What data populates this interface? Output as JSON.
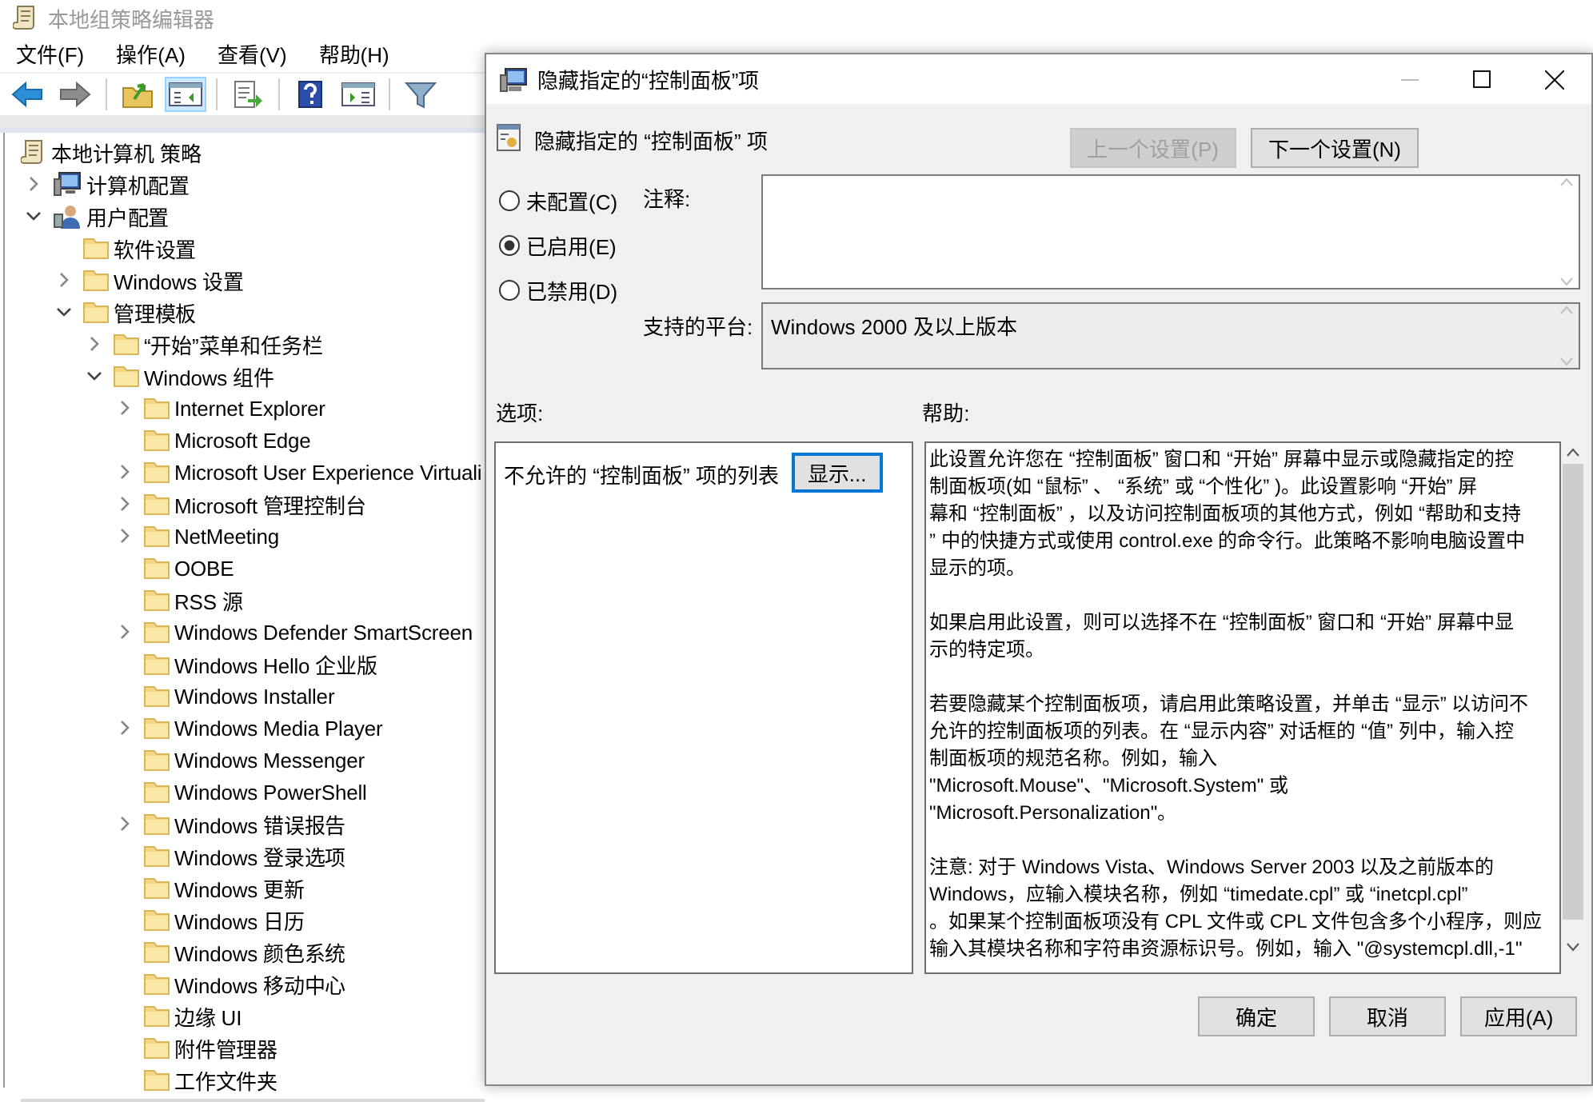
{
  "editor": {
    "title": "本地组策略编辑器",
    "menu": [
      "文件(F)",
      "操作(A)",
      "查看(V)",
      "帮助(H)"
    ],
    "toolbar": [
      [
        {
          "kind": "back",
          "pressed": false
        },
        {
          "kind": "forward",
          "pressed": false
        }
      ],
      [
        {
          "kind": "up",
          "pressed": false
        },
        {
          "kind": "tree",
          "pressed": true
        }
      ],
      [
        {
          "kind": "export",
          "pressed": false
        }
      ],
      [
        {
          "kind": "help",
          "pressed": false
        },
        {
          "kind": "view",
          "pressed": false
        }
      ],
      [
        {
          "kind": "filter",
          "pressed": false
        }
      ]
    ],
    "tree": [
      {
        "label": "本地计算机 策略",
        "kind": "policy",
        "children": [
          {
            "label": "计算机配置",
            "kind": "computer",
            "expandable": true,
            "expanded": false
          },
          {
            "label": "用户配置",
            "kind": "user",
            "expandable": true,
            "expanded": true,
            "children": [
              {
                "label": "软件设置",
                "kind": "folder",
                "expandable": false,
                "expanded": false
              },
              {
                "label": "Windows 设置",
                "kind": "folder",
                "expandable": true,
                "expanded": false
              },
              {
                "label": "管理模板",
                "kind": "folder",
                "expandable": true,
                "expanded": true,
                "children": [
                  {
                    "label": "“开始”菜单和任务栏",
                    "kind": "folder",
                    "expandable": true,
                    "expanded": false
                  },
                  {
                    "label": "Windows 组件",
                    "kind": "folder",
                    "expandable": true,
                    "expanded": true,
                    "children": [
                      {
                        "label": "Internet Explorer",
                        "kind": "folder",
                        "expandable": true,
                        "expanded": false
                      },
                      {
                        "label": "Microsoft Edge",
                        "kind": "folder",
                        "expandable": false,
                        "expanded": false
                      },
                      {
                        "label": "Microsoft User Experience Virtuali",
                        "kind": "folder",
                        "expandable": true,
                        "expanded": false
                      },
                      {
                        "label": "Microsoft 管理控制台",
                        "kind": "folder",
                        "expandable": true,
                        "expanded": false
                      },
                      {
                        "label": "NetMeeting",
                        "kind": "folder",
                        "expandable": true,
                        "expanded": false
                      },
                      {
                        "label": "OOBE",
                        "kind": "folder",
                        "expandable": false,
                        "expanded": false
                      },
                      {
                        "label": "RSS 源",
                        "kind": "folder",
                        "expandable": false,
                        "expanded": false
                      },
                      {
                        "label": "Windows Defender SmartScreen",
                        "kind": "folder",
                        "expandable": true,
                        "expanded": false
                      },
                      {
                        "label": "Windows Hello 企业版",
                        "kind": "folder",
                        "expandable": false,
                        "expanded": false
                      },
                      {
                        "label": "Windows Installer",
                        "kind": "folder",
                        "expandable": false,
                        "expanded": false
                      },
                      {
                        "label": "Windows Media Player",
                        "kind": "folder",
                        "expandable": true,
                        "expanded": false
                      },
                      {
                        "label": "Windows Messenger",
                        "kind": "folder",
                        "expandable": false,
                        "expanded": false
                      },
                      {
                        "label": "Windows PowerShell",
                        "kind": "folder",
                        "expandable": false,
                        "expanded": false
                      },
                      {
                        "label": "Windows 错误报告",
                        "kind": "folder",
                        "expandable": true,
                        "expanded": false
                      },
                      {
                        "label": "Windows 登录选项",
                        "kind": "folder",
                        "expandable": false,
                        "expanded": false
                      },
                      {
                        "label": "Windows 更新",
                        "kind": "folder",
                        "expandable": false,
                        "expanded": false
                      },
                      {
                        "label": "Windows 日历",
                        "kind": "folder",
                        "expandable": false,
                        "expanded": false
                      },
                      {
                        "label": "Windows 颜色系统",
                        "kind": "folder",
                        "expandable": false,
                        "expanded": false
                      },
                      {
                        "label": "Windows 移动中心",
                        "kind": "folder",
                        "expandable": false,
                        "expanded": false
                      },
                      {
                        "label": "边缘 UI",
                        "kind": "folder",
                        "expandable": false,
                        "expanded": false
                      },
                      {
                        "label": "附件管理器",
                        "kind": "folder",
                        "expandable": false,
                        "expanded": false
                      },
                      {
                        "label": "工作文件夹",
                        "kind": "folder",
                        "expandable": false,
                        "expanded": false
                      }
                    ]
                  }
                ]
              }
            ]
          }
        ]
      }
    ]
  },
  "dialog": {
    "title": "隐藏指定的“控制面板”项",
    "setting_title": "隐藏指定的 “控制面板” 项",
    "nav_buttons": [
      {
        "label": "上一个设置(P)",
        "disabled": true
      },
      {
        "label": "下一个设置(N)",
        "disabled": false
      }
    ],
    "radios": [
      {
        "label": "未配置(C)",
        "selected": false
      },
      {
        "label": "已启用(E)",
        "selected": true
      },
      {
        "label": "已禁用(D)",
        "selected": false
      }
    ],
    "comment_label": "注释:",
    "platform_label": "支持的平台:",
    "platform": "Windows 2000 及以上版本",
    "options_label": "选项:",
    "help_label": "帮助:",
    "option": {
      "label": "不允许的 “控制面板” 项的列表",
      "button": "显示...",
      "focused": true
    },
    "help": [
      [
        "此设置允许您在 “控制面板” 窗口和 “开始” 屏幕中显示或隐藏指定的控",
        "制面板项(如 “鼠标” 、 “系统” 或 “个性化” )。此设置影响 “开始” 屏",
        "幕和 “控制面板” ，以及访问控制面板项的其他方式，例如 “帮助和支持",
        "” 中的快捷方式或使用 control.exe 的命令行。此策略不影响电脑设置中",
        "显示的项。"
      ],
      [
        "如果启用此设置，则可以选择不在 “控制面板” 窗口和 “开始” 屏幕中显",
        "示的特定项。"
      ],
      [
        "若要隐藏某个控制面板项，请启用此策略设置，并单击 “显示” 以访问不",
        "允许的控制面板项的列表。在 “显示内容” 对话框的 “值” 列中，输入控",
        "制面板项的规范名称。例如，输入",
        "\"Microsoft.Mouse\"、\"Microsoft.System\" 或",
        "\"Microsoft.Personalization\"。"
      ],
      [
        "注意: 对于 Windows Vista、Windows Server 2003 以及之前版本的",
        "Windows，应输入模块名称，例如 “timedate.cpl” 或 “inetcpl.cpl”",
        "。如果某个控制面板项没有 CPL 文件或 CPL 文件包含多个小程序，则应",
        "输入其模块名称和字符串资源标识号。例如，输入 \"@systemcpl.dll,-1\""
      ]
    ],
    "buttons": [
      {
        "label": "确定",
        "disabled": false
      },
      {
        "label": "取消",
        "disabled": false
      },
      {
        "label": "应用(A)",
        "disabled": false
      }
    ]
  }
}
